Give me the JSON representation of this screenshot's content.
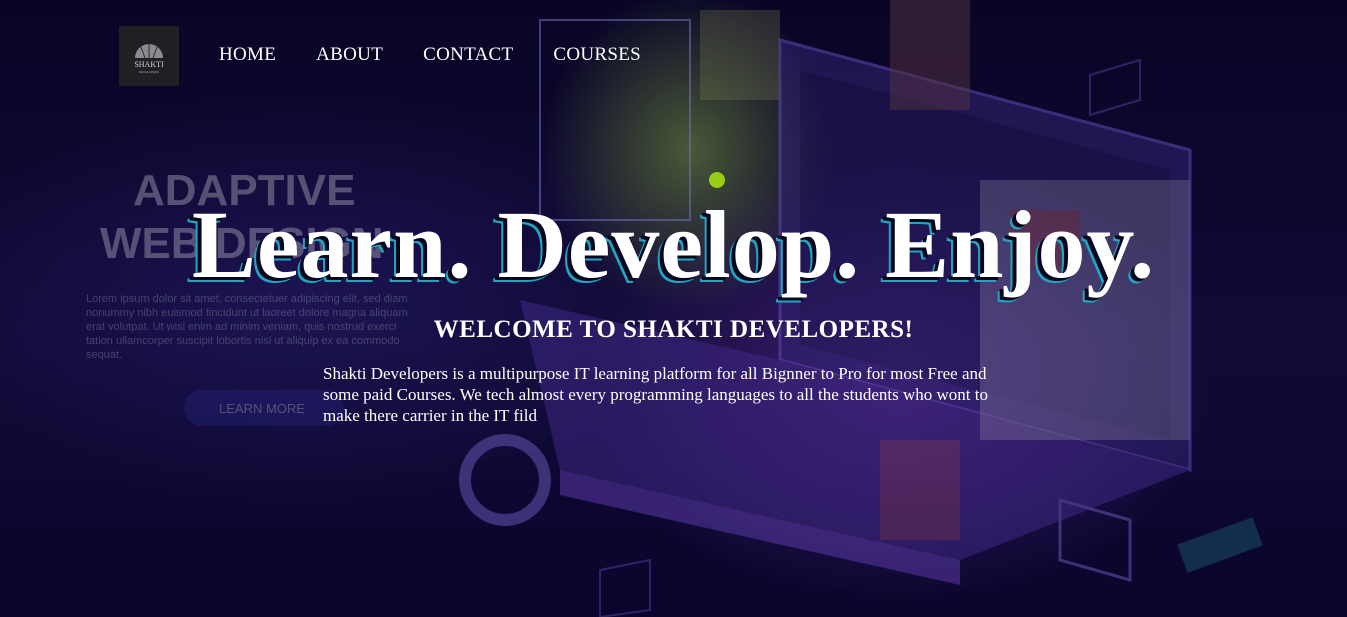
{
  "brand": {
    "logo_text": "SHAKTI",
    "logo_subtext": "DEVELOPERS"
  },
  "nav": {
    "items": [
      "HOME",
      "ABOUT",
      "CONTACT",
      "COURSES"
    ]
  },
  "hero": {
    "headline": "Learn. Develop. Enjoy.",
    "welcome": "WELCOME TO SHAKTI DEVELOPERS!",
    "description": "Shakti Developers is a multipurpose IT learning platform for all Bignner to Pro for most Free and some paid Courses. We tech almost every programming languages to all the students who wont to make there carrier in the IT fild"
  },
  "background_art": {
    "title_line1": "ADAPTIVE",
    "title_line2": "WEB DESIGN",
    "lorem": [
      "Lorem ipsum dolor sit amet, consectetuer adipiscing elit, sed diam",
      "nonummy nibh euismod tincidunt ut laoreet dolore magna aliquam",
      "erat volutpat. Ut wisi enim ad minim veniam, quis nostrud exerci",
      "tation ullamcorper suscipit lobortis nisl ut aliquip ex ea commodo",
      "sequat."
    ],
    "button_label": "LEARN MORE"
  },
  "colors": {
    "background": "#0b0630",
    "accent_dot": "#9acd16",
    "headline_shadow": "#1ea7c4",
    "logo_bg": "#202024"
  }
}
